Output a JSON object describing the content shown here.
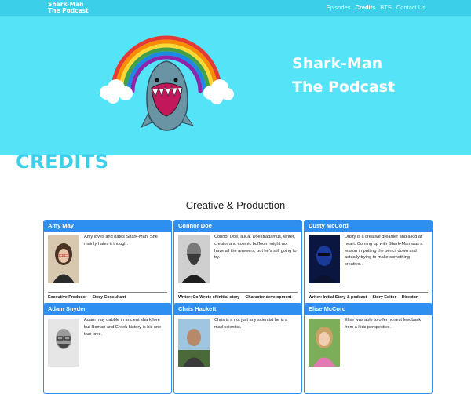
{
  "brand": {
    "line1": "Shark-Man",
    "line2": "The Podcast"
  },
  "nav": [
    "Episodes",
    "Credits",
    "BTS",
    "Contact Us"
  ],
  "nav_active": "Credits",
  "hero": {
    "line1": "Shark-Man",
    "line2": "The Podcast"
  },
  "colors": {
    "nav_bg": "#3ccfea",
    "hero_bg": "#55e3f7",
    "accent": "#2f8ff0"
  },
  "page_heading": "CREDITS",
  "section_title": "Creative & Production",
  "cards": [
    {
      "name": "Amy May",
      "bio": "Amy loves and hates Shark-Man. She mainly hates it though.",
      "roles": [
        "Executive Producer",
        "Story Consultant"
      ]
    },
    {
      "name": "Connor Doe",
      "bio": "Connor Doe, a.k.a. Doestradamus, writer, creator and cosmic buffoon, might not have all the answers, but he's still going to try.",
      "roles": [
        "Writer: Co-Wrote of initial story",
        "Character development"
      ]
    },
    {
      "name": "Dusty McCord",
      "bio": "Dusty is a creative dreamer and a kid at heart. Coming up with Shark-Man was a lesson in putting the pencil down and actually trying to make something creative.",
      "roles": [
        "Writer: Initial Story & podcast",
        "Story Editor",
        "Director"
      ]
    },
    {
      "name": "Adam Snyder",
      "bio": "Adam may dabble in ancient shark lore but Roman and Greek history is his one true love.",
      "roles": []
    },
    {
      "name": "Chris Hackett",
      "bio": "Chris is a not just any scientist he is a mad scientist.",
      "roles": []
    },
    {
      "name": "Elise McCord",
      "bio": "Elise was able to offer honest feedback from a kids perspective.",
      "roles": []
    }
  ]
}
